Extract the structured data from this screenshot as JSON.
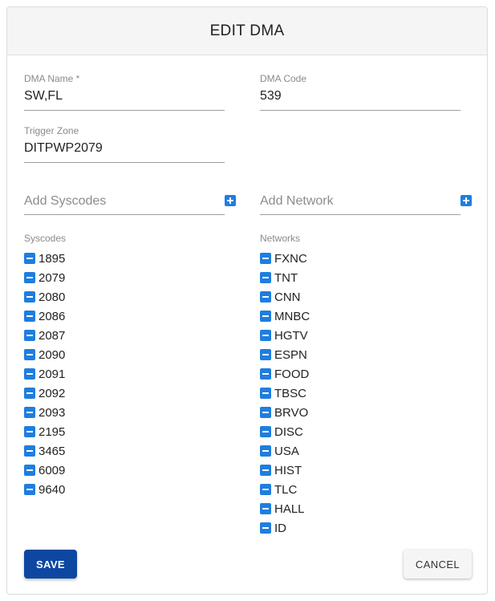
{
  "dialog": {
    "title": "EDIT DMA"
  },
  "fields": {
    "dma_name": {
      "label": "DMA Name *",
      "value": "SW,FL"
    },
    "dma_code": {
      "label": "DMA Code",
      "value": "539"
    },
    "trigger_zone": {
      "label": "Trigger Zone",
      "value": "DITPWP2079"
    }
  },
  "add_syscodes": {
    "placeholder": "Add Syscodes",
    "icon": "plus-square-icon"
  },
  "add_network": {
    "placeholder": "Add Network",
    "icon": "plus-square-icon"
  },
  "syscodes": {
    "header": "Syscodes",
    "items": [
      "1895",
      "2079",
      "2080",
      "2086",
      "2087",
      "2090",
      "2091",
      "2092",
      "2093",
      "2195",
      "3465",
      "6009",
      "9640"
    ]
  },
  "networks": {
    "header": "Networks",
    "items": [
      "FXNC",
      "TNT",
      "CNN",
      "MNBC",
      "HGTV",
      "ESPN",
      "FOOD",
      "TBSC",
      "BRVO",
      "DISC",
      "USA",
      "HIST",
      "TLC",
      "HALL",
      "ID"
    ]
  },
  "remove_icon": "minus-square-icon",
  "actions": {
    "save_label": "SAVE",
    "cancel_label": "CANCEL"
  },
  "colors": {
    "accent": "#1e7ee0",
    "primary_button": "#0d47a1"
  }
}
